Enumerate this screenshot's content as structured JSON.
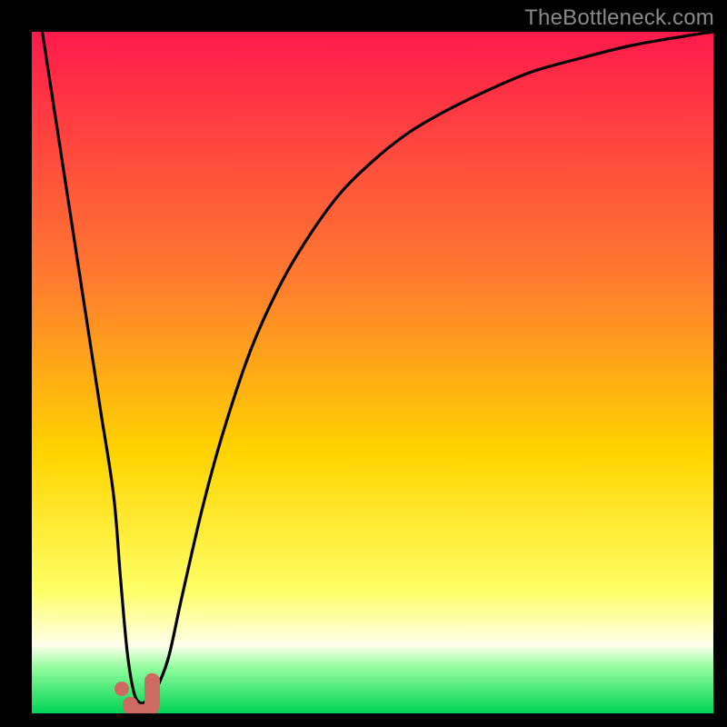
{
  "watermark": "TheBottleneck.com",
  "colors": {
    "frame": "#000000",
    "curve": "#000000",
    "marker_fill": "#cd6a61",
    "marker_stroke": "#cd6a61",
    "gradient_top": "#ff1a4b",
    "gradient_mid_upper": "#ff7a2f",
    "gradient_mid": "#ffd400",
    "gradient_mid_lower": "#ffff66",
    "gradient_pale": "#fdffe9",
    "gradient_green_top": "#8dfc9a",
    "gradient_green_bottom": "#00d455"
  },
  "chart_data": {
    "type": "line",
    "title": "",
    "xlabel": "",
    "ylabel": "",
    "xlim": [
      0,
      100
    ],
    "ylim": [
      0,
      100
    ],
    "series": [
      {
        "name": "bottleneck-curve",
        "x": [
          0,
          2,
          4,
          6,
          8,
          10,
          12,
          13,
          14,
          15,
          16,
          17,
          18,
          20,
          22,
          25,
          28,
          32,
          36,
          40,
          45,
          50,
          55,
          60,
          66,
          73,
          80,
          88,
          96,
          100
        ],
        "y": [
          110,
          97,
          84,
          71,
          58,
          45,
          32,
          20,
          9,
          3,
          1.5,
          2,
          3,
          8,
          17,
          30,
          41,
          53,
          62,
          69,
          76,
          81,
          85,
          88,
          91,
          94,
          96,
          98,
          99.4,
          100
        ]
      }
    ],
    "markers": [
      {
        "name": "left-foot-dot",
        "x": 13.2,
        "y": 3.6
      },
      {
        "name": "valley-blob",
        "shape": "J",
        "cx": 15.8,
        "cy": 2.1
      }
    ],
    "gradient_stops_pct": [
      {
        "pct": 0,
        "key": "gradient_top"
      },
      {
        "pct": 36,
        "key": "gradient_mid_upper"
      },
      {
        "pct": 62,
        "key": "gradient_mid"
      },
      {
        "pct": 82,
        "key": "gradient_mid_lower"
      },
      {
        "pct": 90,
        "key": "gradient_pale"
      },
      {
        "pct": 93.5,
        "key": "gradient_green_top"
      },
      {
        "pct": 100,
        "key": "gradient_green_bottom"
      }
    ]
  }
}
